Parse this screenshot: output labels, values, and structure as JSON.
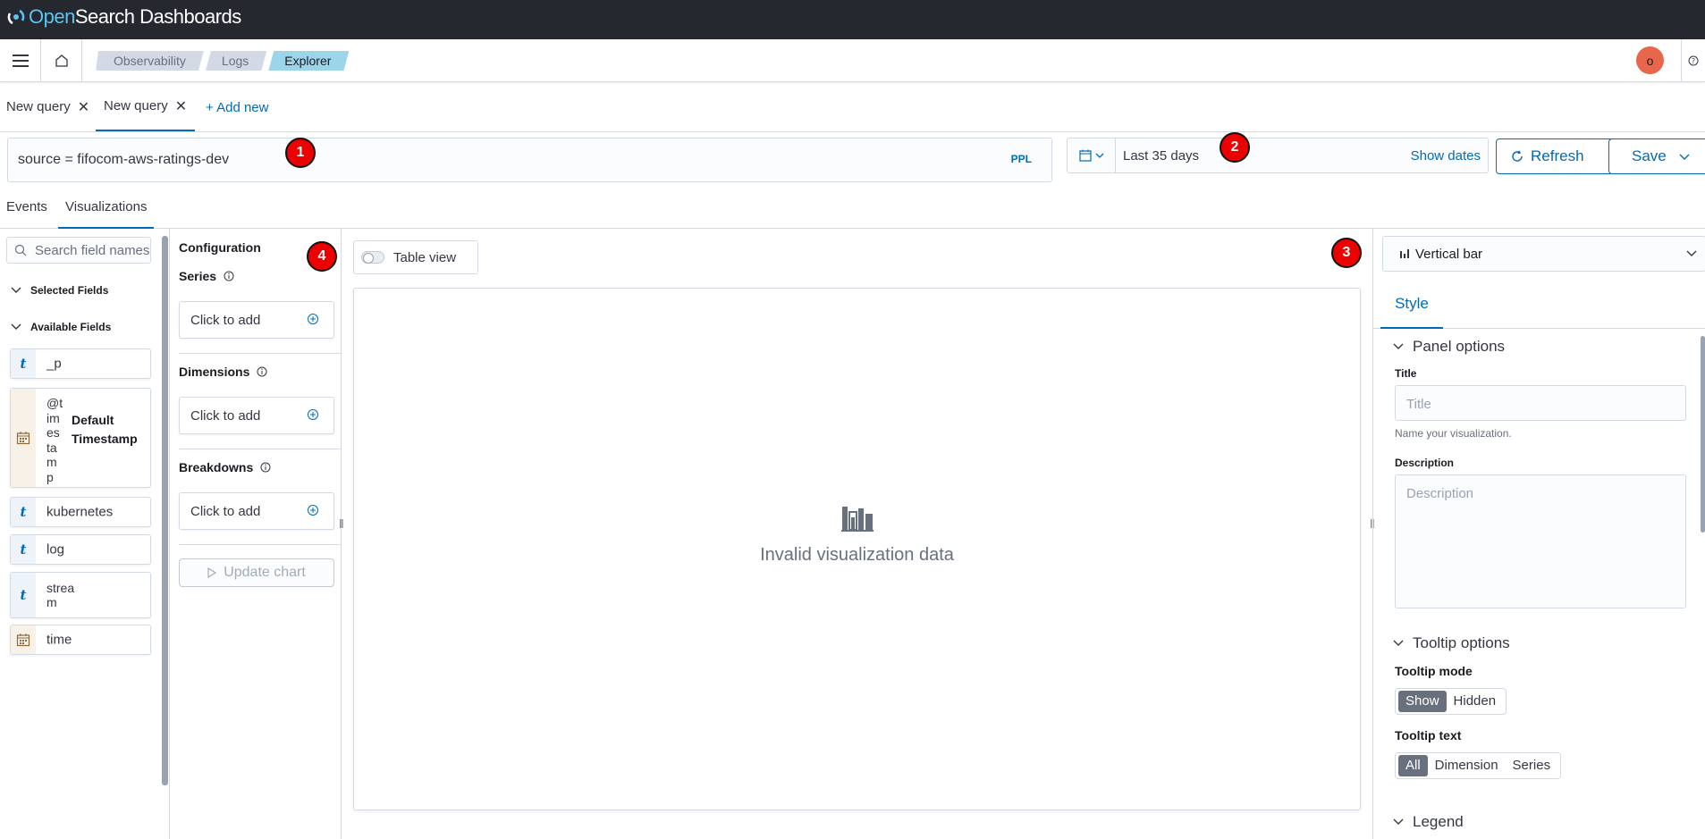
{
  "app": {
    "brand_open": "Open",
    "brand_rest": "Search Dashboards"
  },
  "header": {
    "breadcrumbs": [
      "Observability",
      "Logs",
      "Explorer"
    ],
    "avatar_initial": "o"
  },
  "query_tabs": {
    "tabs": [
      {
        "label": "New query"
      },
      {
        "label": "New query"
      }
    ],
    "add_new": "+ Add new"
  },
  "search": {
    "query": "source = fifocom-aws-ratings-dev",
    "language": "PPL",
    "date_range": "Last 35 days",
    "show_dates": "Show dates",
    "refresh": "Refresh",
    "save": "Save"
  },
  "badges": [
    "1",
    "2",
    "3",
    "4"
  ],
  "sub_tabs": [
    "Events",
    "Visualizations"
  ],
  "sidebar": {
    "search_placeholder": "Search field names",
    "selected_fields": "Selected Fields",
    "available_fields": "Available Fields",
    "fields": [
      {
        "type": "t",
        "name": "_p"
      },
      {
        "type": "date",
        "name": "@timestamp",
        "name_wrapped": [
          "@t",
          "im",
          "es",
          "ta",
          "m",
          "p"
        ],
        "note": "Default Timestamp"
      },
      {
        "type": "t",
        "name": "kubernetes"
      },
      {
        "type": "t",
        "name": "log"
      },
      {
        "type": "t",
        "name": "stream",
        "name_wrapped": [
          "strea",
          "m"
        ]
      },
      {
        "type": "date",
        "name": "time"
      }
    ]
  },
  "config": {
    "title": "Configuration",
    "series": "Series",
    "dimensions": "Dimensions",
    "breakdowns": "Breakdowns",
    "click_to_add": "Click to add",
    "update_chart": "Update chart"
  },
  "canvas": {
    "table_view": "Table view",
    "empty_message": "Invalid visualization data"
  },
  "right_panel": {
    "vis_type": "Vertical bar",
    "tab_style": "Style",
    "panel_options": "Panel options",
    "title_label": "Title",
    "title_placeholder": "Title",
    "title_help": "Name your visualization.",
    "description_label": "Description",
    "description_placeholder": "Description",
    "tooltip_options": "Tooltip options",
    "tooltip_mode": "Tooltip mode",
    "tooltip_mode_options": [
      "Show",
      "Hidden"
    ],
    "tooltip_text": "Tooltip text",
    "tooltip_text_options": [
      "All",
      "Dimension",
      "Series"
    ],
    "legend": "Legend"
  },
  "colors": {
    "accent": "#006bb8",
    "topbar": "#25282f",
    "avatar": "#e7664c",
    "badge": "#ee0000"
  }
}
